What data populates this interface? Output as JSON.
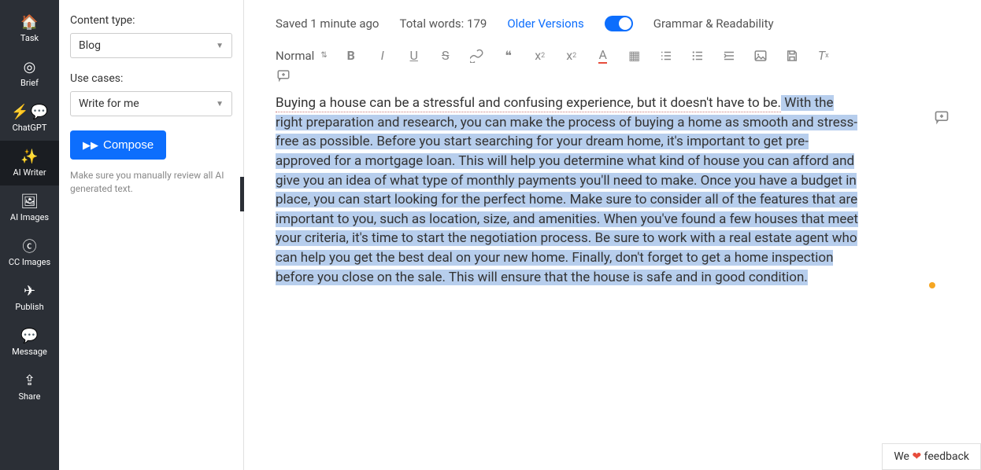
{
  "nav": {
    "items": [
      {
        "label": "Task"
      },
      {
        "label": "Brief"
      },
      {
        "label": "ChatGPT"
      },
      {
        "label": "AI Writer"
      },
      {
        "label": "AI Images"
      },
      {
        "label": "CC Images"
      },
      {
        "label": "Publish"
      },
      {
        "label": "Message"
      },
      {
        "label": "Share"
      }
    ]
  },
  "panel": {
    "content_type_label": "Content type:",
    "content_type_value": "Blog",
    "use_cases_label": "Use cases:",
    "use_cases_value": "Write for me",
    "compose_label": "Compose",
    "help_text": "Make sure you manually review all AI generated text."
  },
  "topbar": {
    "saved": "Saved 1 minute ago",
    "words": "Total words: 179",
    "older_versions": "Older Versions",
    "grammar": "Grammar & Readability"
  },
  "toolbar": {
    "format_select": "Normal"
  },
  "editor": {
    "intro": "Buying a house can be a stressful and confusing experience, but it doesn't have to be.",
    "body": " With the right preparation and research, you can make the process of buying a home as smooth and stress-free as possible. Before you start searching for your dream home, it's important to get pre-approved for a mortgage loan. This will help you determine what kind of house you can afford and give you an idea of what type of monthly payments you'll need to make. Once you have a budget in place, you can start looking for the perfect home. Make sure to consider all of the features that are important to you, such as location, size, and amenities. When you've found a few houses that meet your criteria, it's time to start the negotiation process. Be sure to work with a real estate agent who can help you get the best deal on your new home. Finally, don't forget to get a home inspection before you close on the sale. This will ensure that the house is safe and in good condition."
  },
  "feedback": {
    "prefix": "We ",
    "suffix": " feedback"
  }
}
